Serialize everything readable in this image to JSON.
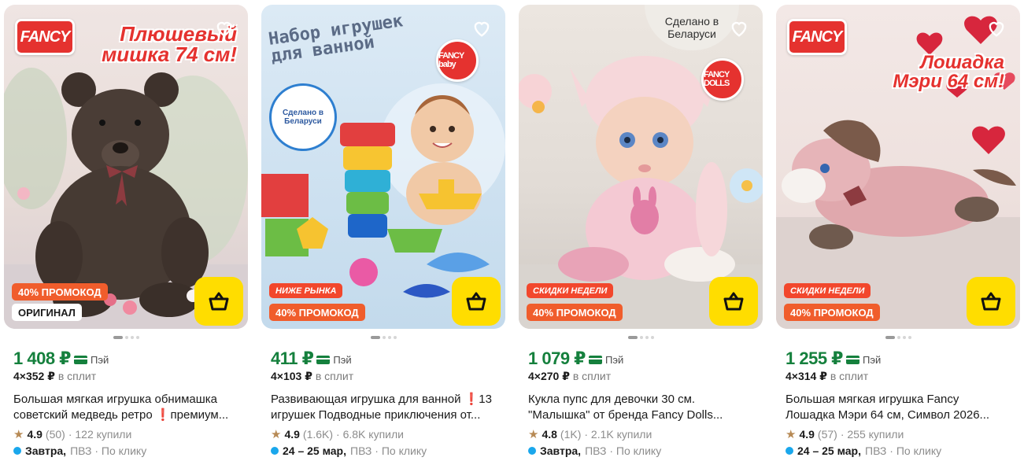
{
  "products": [
    {
      "promo_title": "Плюшевый мишка 74 см!",
      "brand": "FANCY",
      "badges": [
        "40% ПРОМОКОД",
        "ОРИГИНАЛ"
      ],
      "price": "1 408 ₽",
      "pay_label": "Пэй",
      "split_amount": "4×352 ₽",
      "split_label": "в сплит",
      "title_line1": "Большая мягкая игрушка обнимашка",
      "title_line2": "советский медведь ретро ❗премиум...",
      "rating": "4.9",
      "reviews": "(50)",
      "bought": "· 122 купили",
      "delivery_when": "Завтра,",
      "delivery_where": "ПВЗ · По клику"
    },
    {
      "promo_title": "Набор игрушек для ванной",
      "brand": "FANCY baby",
      "stamp": "Сделано в Беларуси",
      "badges": [
        "НИЖЕ РЫНКА",
        "40% ПРОМОКОД"
      ],
      "price": "411 ₽",
      "pay_label": "Пэй",
      "split_amount": "4×103 ₽",
      "split_label": "в сплит",
      "title_line1": "Развивающая игрушка для ванной ❗13",
      "title_line2": "игрушек Подводные приключения от...",
      "rating": "4.9",
      "reviews": "(1.6K)",
      "bought": "· 6.8K купили",
      "delivery_when": "24 – 25 мар,",
      "delivery_where": "ПВЗ · По клику"
    },
    {
      "promo_title": "Сделано в Беларуси",
      "brand": "FANCY DOLLS",
      "badges": [
        "СКИДКИ НЕДЕЛИ",
        "40% ПРОМОКОД"
      ],
      "price": "1 079 ₽",
      "pay_label": "Пэй",
      "split_amount": "4×270 ₽",
      "split_label": "в сплит",
      "title_line1": "Кукла пупс для девочки 30 см.",
      "title_line2": "\"Малышка\" от бренда Fancy Dolls...",
      "rating": "4.8",
      "reviews": "(1K)",
      "bought": "· 2.1K купили",
      "delivery_when": "Завтра,",
      "delivery_where": "ПВЗ · По клику"
    },
    {
      "promo_title": "Лошадка Мэри 64 см!",
      "brand": "FANCY",
      "badges": [
        "СКИДКИ НЕДЕЛИ",
        "40% ПРОМОКОД"
      ],
      "price": "1 255 ₽",
      "pay_label": "Пэй",
      "split_amount": "4×314 ₽",
      "split_label": "в сплит",
      "title_line1": "Большая мягкая игрушка Fancy",
      "title_line2": "Лошадка Мэри 64 см, Символ 2026...",
      "rating": "4.9",
      "reviews": "(57)",
      "bought": "· 255 купили",
      "delivery_when": "24 – 25 мар,",
      "delivery_where": "ПВЗ · По клику"
    }
  ],
  "colors": {
    "price": "#15803d",
    "badge": "#f05d2c",
    "cart": "#ffdd00",
    "delivery_dot": "#1aa7ec",
    "star": "#b78a55"
  },
  "icons": [
    "heart-icon",
    "cart-icon",
    "star-icon",
    "pay-card-icon"
  ]
}
